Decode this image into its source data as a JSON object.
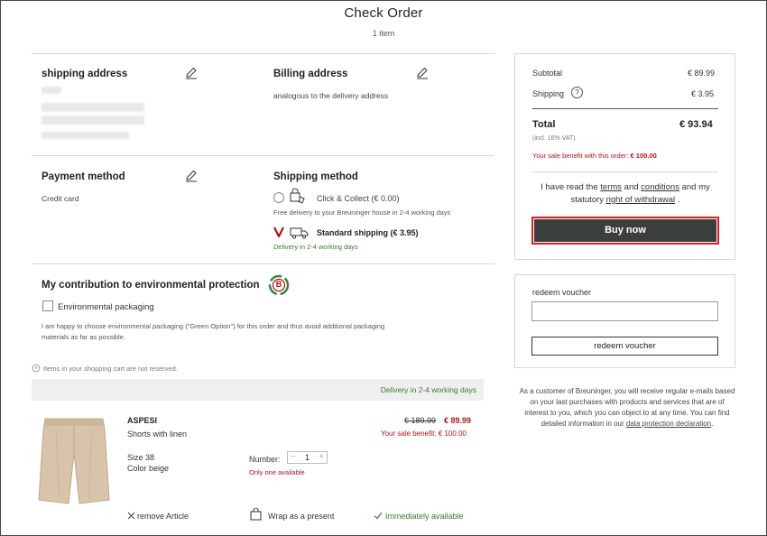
{
  "header": {
    "title": "Check Order",
    "item_count": "1 item"
  },
  "shipping_address": {
    "title": "shipping address"
  },
  "billing_address": {
    "title": "Billing address",
    "text": "analogous to the delivery address"
  },
  "payment": {
    "title": "Payment method",
    "value": "Credit card"
  },
  "shipping_method": {
    "title": "Shipping method",
    "click_collect_label": "Click & Collect (€ 0.00)",
    "click_collect_note": "Free delivery to your Breuninger house in 2-4 working days",
    "standard_label": "Standard shipping (€ 3.95)",
    "standard_note": "Delivery in 2-4 working days"
  },
  "environment": {
    "title": "My contribution to environmental protection",
    "badge_letter": "B",
    "checkbox_label": "Environmental packaging",
    "description_line1": "I am happy to choose environmental packaging (\"Green Option\") for this order and thus avoid additional packaging",
    "description_line2": "materials as far as possible."
  },
  "cart_note": "Items in your shopping cart are not reserved.",
  "delivery_bar": "Delivery in 2-4 working days",
  "product": {
    "brand": "ASPESI",
    "name": "Shorts with linen",
    "size": "Size 38",
    "color": "Color beige",
    "old_price": "€ 189.99",
    "price": "€ 89.99",
    "benefit": "Your sale benefit: € 100.00",
    "number_label": "Number:",
    "quantity": "1",
    "minus": "−",
    "plus": "+",
    "only_one": "Only one available",
    "remove": "remove Article",
    "wrap": "Wrap as a present",
    "availability": "Immediately available"
  },
  "summary": {
    "subtotal_label": "Subtotal",
    "subtotal_value": "€ 89.99",
    "shipping_label": "Shipping",
    "shipping_value": "€ 3.95",
    "total_label": "Total",
    "total_value": "€ 93.94",
    "vat": "(incl. 16% VAT)",
    "sale_benefit_label": "Your sale benefit with this order:",
    "sale_benefit_value": "€ 100.00",
    "terms_1": "I have read the",
    "terms_link": "terms",
    "terms_2": "and",
    "conditions_link": "conditions",
    "terms_3": "and my",
    "terms_4": "statutory",
    "withdrawal_link": "right of withdrawal",
    "terms_5": ".",
    "buy_now": "Buy now"
  },
  "voucher": {
    "label": "redeem voucher",
    "button": "redeem voucher"
  },
  "info": {
    "text": "As a customer of Breuninger, you will receive regular e-mails based on your last purchases with products and services that are of interest to you, which you can object to at any time. You can find detailed information in our",
    "link": "data protection declaration",
    "end": "."
  },
  "colors": {
    "accent_red": "#b0121b",
    "green": "#3a7a2e",
    "button_dark": "#3b3f3c",
    "highlight": "#e01a22"
  }
}
